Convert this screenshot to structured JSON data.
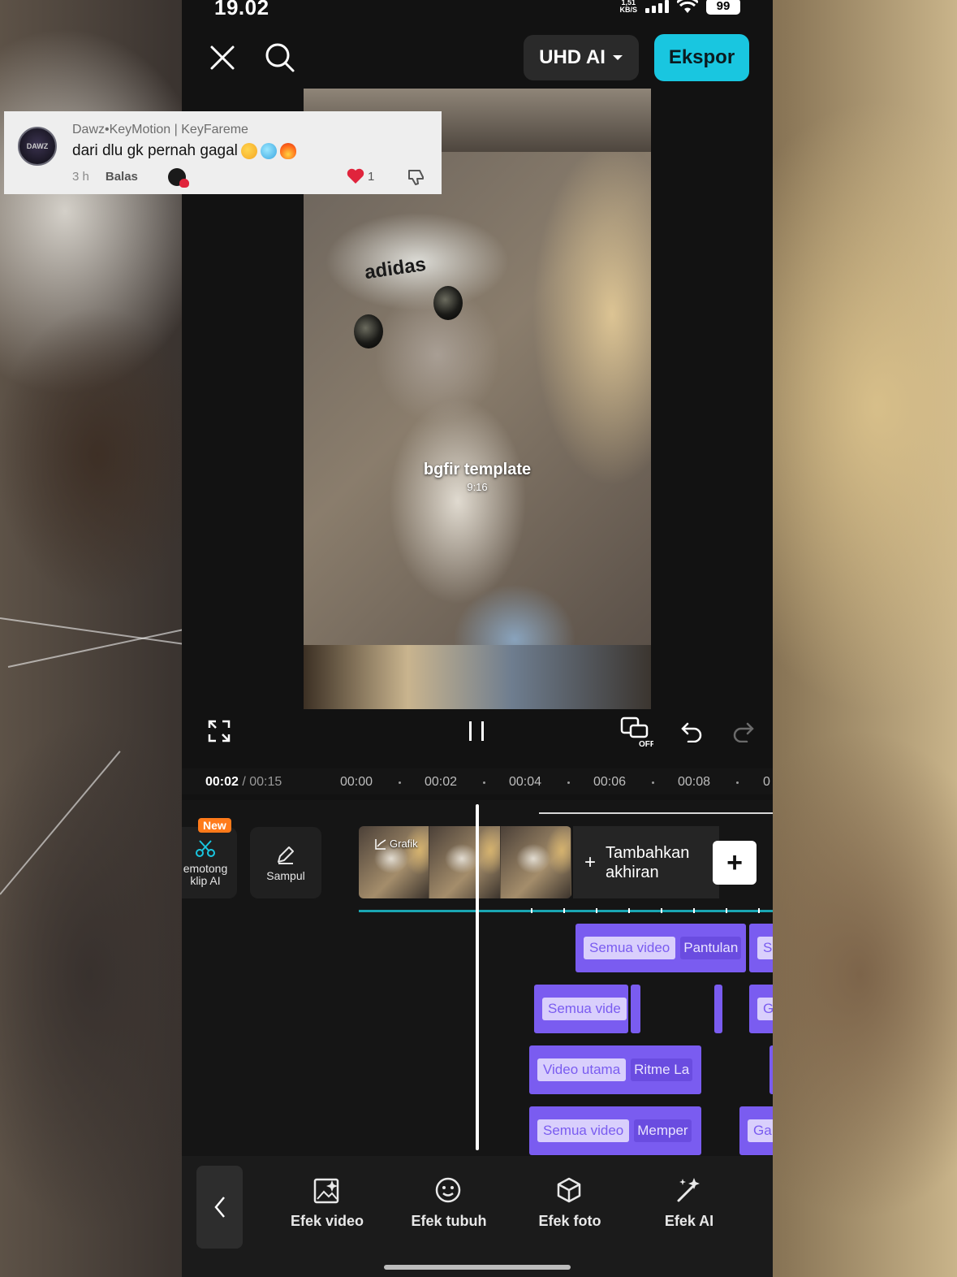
{
  "status": {
    "time": "19.02",
    "net_speed_value": "1,51",
    "net_speed_unit": "KB/S",
    "battery": "99"
  },
  "topbar": {
    "quality_label": "UHD AI",
    "export_label": "Ekspor"
  },
  "preview": {
    "cap_brand": "adidas",
    "watermark_title": "bgfir template",
    "watermark_ratio": "9:16"
  },
  "controls": {
    "current_time": "00:02",
    "total_time": " / 00:15",
    "ruler": [
      "00:00",
      "00:02",
      "00:04",
      "00:06",
      "00:08",
      "0"
    ]
  },
  "timeline": {
    "new_badge": "New",
    "ai_cut_label_1": "emotong",
    "ai_cut_label_2": "klip AI",
    "cover_label": "Sampul",
    "clip_effect_label": "Grafik",
    "add_ending_line1": "Tambahkan",
    "add_ending_line2": "akhiran",
    "effect_tracks": [
      {
        "chip": "Semua video",
        "name": "Pantulan",
        "extra": "S"
      },
      {
        "chip": "Semua vide",
        "name": "",
        "extra": "G"
      },
      {
        "chip": "Video utama",
        "name": "Ritme La",
        "extra": ""
      },
      {
        "chip": "Semua video",
        "name": "Memper",
        "extra": "Ga"
      }
    ]
  },
  "toolbar": {
    "items": [
      {
        "label": "Efek video",
        "icon": "image-sparkle-icon"
      },
      {
        "label": "Efek tubuh",
        "icon": "smile-face-icon"
      },
      {
        "label": "Efek foto",
        "icon": "cube-sparkle-icon"
      },
      {
        "label": "Efek AI",
        "icon": "magic-wand-icon"
      }
    ]
  },
  "comment": {
    "author": "Dawz•KeyMotion | KeyFareme",
    "text": "dari dlu gk pernah gagal",
    "age": "3 h",
    "reply": "Balas",
    "likes": "1",
    "avatar_text": "DAWZ"
  },
  "colors": {
    "accent": "#19c6e0",
    "effect_track": "#7a5cf0",
    "new_badge": "#ff7a1a",
    "like_heart": "#e0243c"
  }
}
